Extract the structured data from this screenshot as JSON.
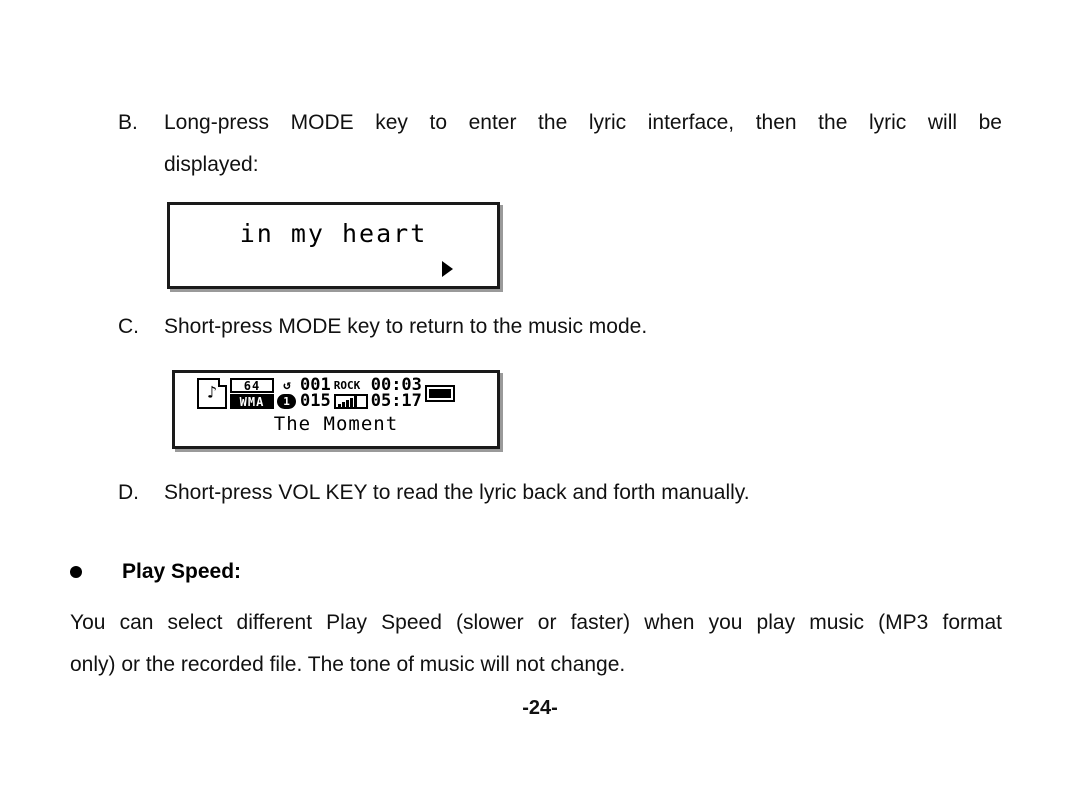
{
  "document": {
    "page_number": "-24-"
  },
  "items": [
    {
      "letter": "B.",
      "line1": "Long-press MODE key to enter the lyric interface, then the lyric will be",
      "line2": "displayed:"
    },
    {
      "letter": "C.",
      "line1": "Short-press MODE key to return to the music mode."
    },
    {
      "letter": "D.",
      "line1": "Short-press VOL KEY to read the lyric back and forth manually."
    }
  ],
  "lcd_lyric": {
    "name": "lyric-display",
    "text": "in my heart",
    "indicator": "play-caret-icon"
  },
  "lcd_music": {
    "name": "music-status-display",
    "folder_icon": "folder-music-note-icon",
    "bitrate": "64",
    "format": "WMA",
    "repeat_icon": "repeat-icon",
    "repeat_count_badge": "1",
    "track_number": "001",
    "total_tracks": "015",
    "equalizer": "ROCK",
    "volume_icon": "volume-bars-icon",
    "elapsed_time": "00:03",
    "total_time": "05:17",
    "battery_icon": "battery-full-icon",
    "track_title": "The Moment"
  },
  "section": {
    "bullet_icon": "bullet-dot-icon",
    "heading": "Play Speed:",
    "paragraph_line1": "You can select different Play Speed (slower or faster) when you play music (MP3 format",
    "paragraph_line2": "only) or the recorded file. The tone of music will not change."
  }
}
